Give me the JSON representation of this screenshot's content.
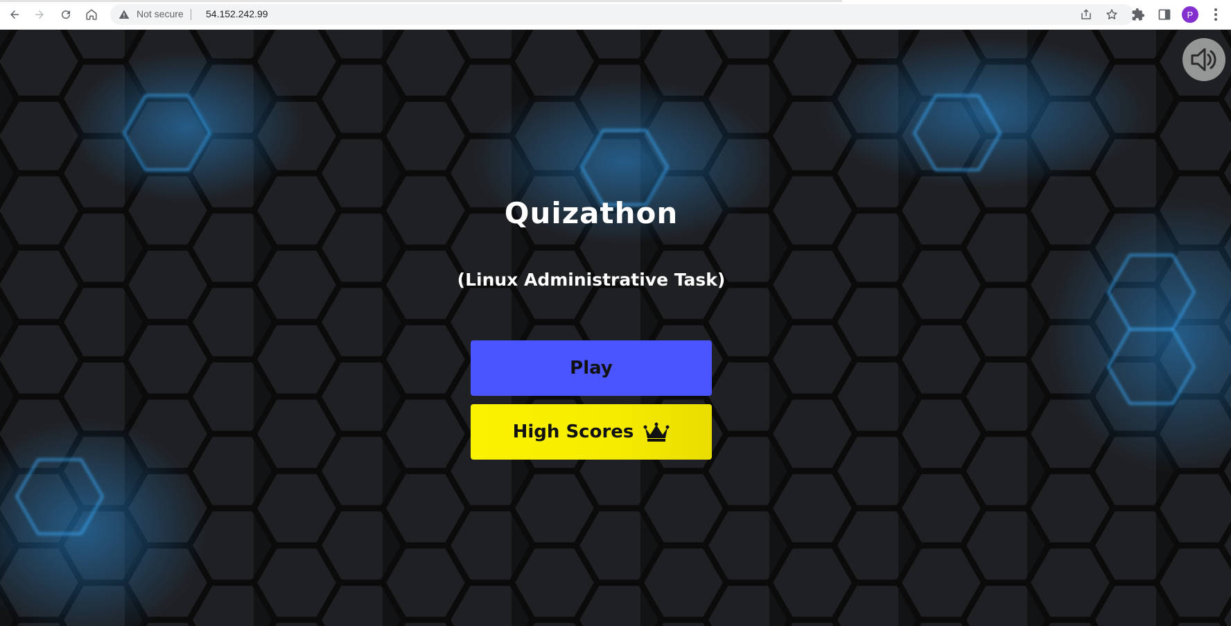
{
  "browser": {
    "security_label": "Not secure",
    "url": "54.152.242.99",
    "profile_initial": "P",
    "icons": [
      "back-icon",
      "forward-icon",
      "reload-icon",
      "home-icon",
      "warning-icon",
      "share-icon",
      "star-icon",
      "extensions-icon",
      "side-panel-icon",
      "menu-icon"
    ]
  },
  "page": {
    "title": "Quizathon",
    "subtitle": "(Linux Administrative Task)",
    "play_label": "Play",
    "high_scores_label": "High Scores",
    "sound_icon": "speaker-icon",
    "crown_icon": "crown-icon"
  },
  "colors": {
    "background": "#1b1c1e",
    "hex_glow": "#2a8cd8",
    "play_button": "#4a54ff",
    "high_scores_button": "#f5ec00"
  }
}
